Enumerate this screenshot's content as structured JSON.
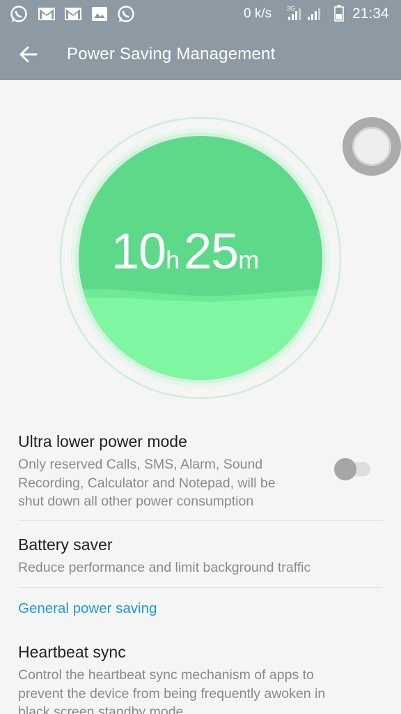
{
  "status_bar": {
    "notification_icons": [
      "whatsapp-icon",
      "gmail-icon",
      "gmail-icon",
      "image-icon",
      "whatsapp-icon"
    ],
    "net_speed": "0 k/s",
    "network_type": "3G",
    "time": "21:34"
  },
  "app_bar": {
    "back_icon": "arrow-back-icon",
    "title": "Power Saving Management"
  },
  "battery_estimate": {
    "hours": "10",
    "hours_unit": "h",
    "minutes": "25",
    "minutes_unit": "m"
  },
  "settings": {
    "ultra_low_power": {
      "title": "Ultra lower power mode",
      "desc_lines": [
        "Only reserved Calls, SMS, Alarm, Sound",
        "Recording, Calculator and Notepad, will be",
        "shut down all other power consumption"
      ],
      "enabled": false
    },
    "battery_saver": {
      "title": "Battery saver",
      "desc": "Reduce performance and limit background traffic"
    },
    "section_general": "General power saving",
    "heartbeat_sync": {
      "title": "Heartbeat sync",
      "desc_lines": [
        "Control the heartbeat sync mechanism of apps to",
        "prevent the device from being frequently awoken in",
        "black screen standby mode"
      ]
    }
  },
  "colors": {
    "app_bar": "#8e9aa3",
    "gauge_green": "#5dd98a",
    "gauge_light_green": "#7ef5a0",
    "accent_blue": "#1e9ad6"
  }
}
